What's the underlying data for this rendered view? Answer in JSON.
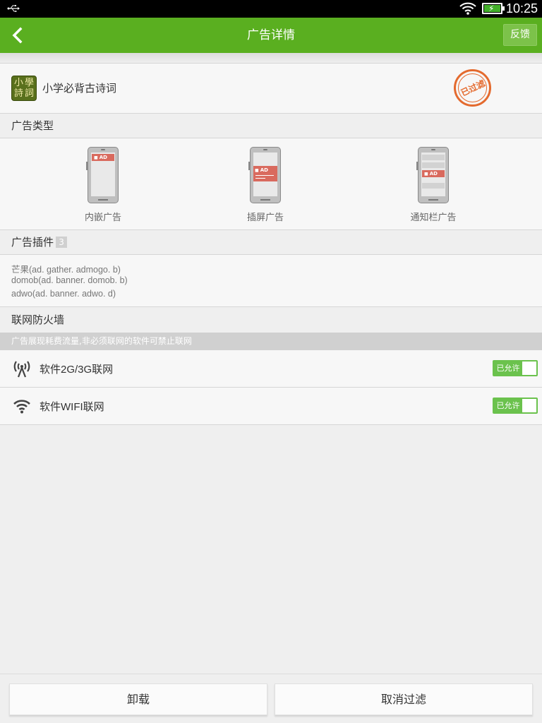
{
  "status_bar": {
    "time": "10:25",
    "icons": [
      "usb-icon",
      "wifi-icon",
      "battery-charging-icon"
    ]
  },
  "app_bar": {
    "title": "广告详情",
    "back_icon": "back-arrow-icon",
    "feedback_label": "反馈",
    "color": "#5aaf20"
  },
  "app": {
    "name": "小学必背古诗词",
    "icon_text": [
      "小",
      "學",
      "詩",
      "詞"
    ],
    "stamp_text": "已过滤",
    "stamp_color": "#e46a2e"
  },
  "ad_types": {
    "header": "广告类型",
    "items": [
      {
        "label": "内嵌广告",
        "ad_label": "AD"
      },
      {
        "label": "插屏广告",
        "ad_label": "AD"
      },
      {
        "label": "通知栏广告",
        "ad_label": "AD"
      }
    ]
  },
  "ad_plugins": {
    "header": "广告插件",
    "count": "3",
    "items": [
      "芒果(ad. gather. admogo. b)",
      "domob(ad. banner. domob. b)",
      "adwo(ad. banner. adwo. d)"
    ]
  },
  "firewall": {
    "header": "联网防火墙",
    "notice": "广告展现耗费流量,非必须联网的软件可禁止联网",
    "rows": [
      {
        "label": "软件2G/3G联网",
        "icon": "cellular-antenna-icon",
        "toggle": "已允许"
      },
      {
        "label": "软件WIFI联网",
        "icon": "wifi-icon",
        "toggle": "已允许"
      }
    ],
    "toggle_color": "#6bc24d"
  },
  "bottom_buttons": {
    "uninstall": "卸载",
    "cancel_filter": "取消过滤"
  }
}
